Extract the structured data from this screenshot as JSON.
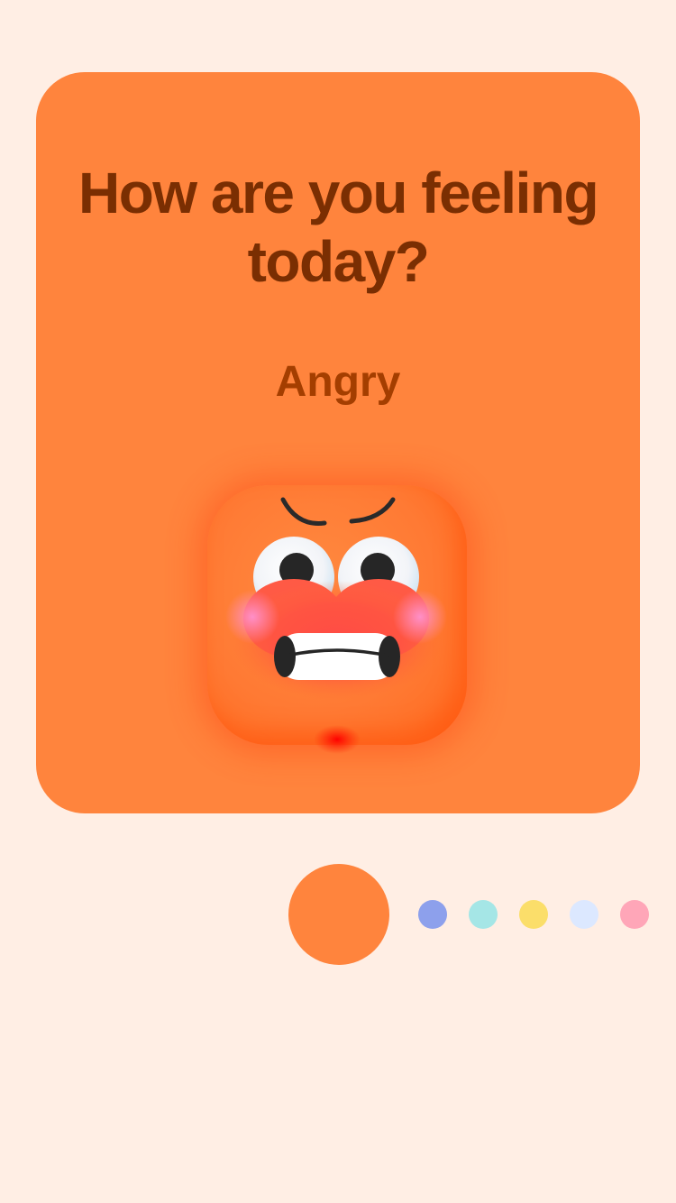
{
  "card": {
    "title": "How are you feeling today?",
    "mood_label": "Angry",
    "background": "#FF843D"
  },
  "mood_face": {
    "icon": "angry-face-icon",
    "mood": "angry"
  },
  "pager": {
    "selected_index": 0,
    "dots": [
      {
        "mood": "angry",
        "color": "#FF843D"
      },
      {
        "mood": "dot-2",
        "color": "#8DA0EC"
      },
      {
        "mood": "dot-3",
        "color": "#A5E6E6"
      },
      {
        "mood": "dot-4",
        "color": "#FBDE6A"
      },
      {
        "mood": "dot-5",
        "color": "#DCE8FF"
      },
      {
        "mood": "dot-6",
        "color": "#FFA6B8"
      }
    ]
  },
  "colors": {
    "page_background": "#FFEEE4",
    "title_text": "#7A2E02",
    "label_text": "#A43E00"
  }
}
